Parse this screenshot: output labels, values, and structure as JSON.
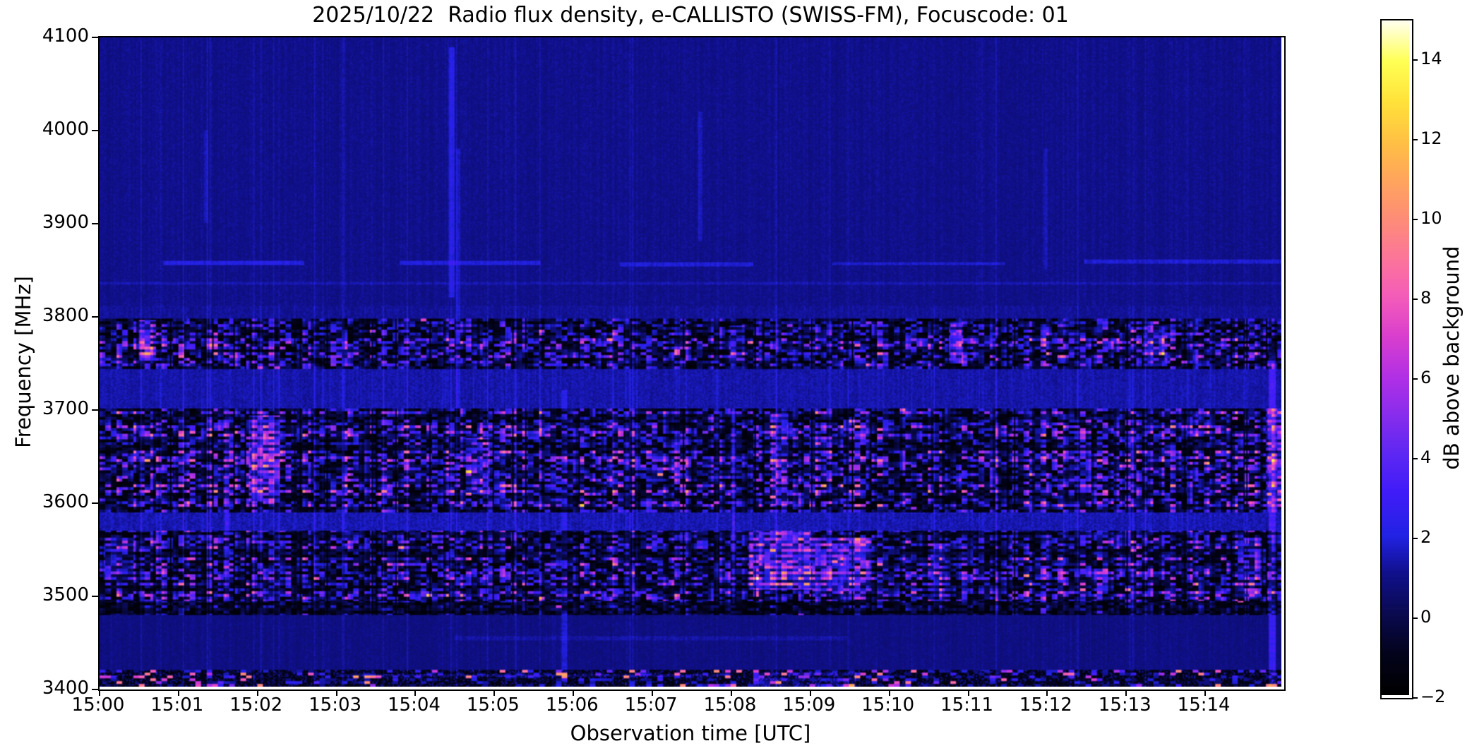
{
  "title": "2025/10/22  Radio flux density, e-CALLISTO (SWISS-FM), Focuscode: 01",
  "chart_data": {
    "type": "heatmap",
    "title": "2025/10/22  Radio flux density, e-CALLISTO (SWISS-FM), Focuscode: 01",
    "xlabel": "Observation time [UTC]",
    "ylabel": "Frequency [MHz]",
    "x_ticks": [
      "15:00",
      "15:01",
      "15:02",
      "15:03",
      "15:04",
      "15:05",
      "15:06",
      "15:07",
      "15:08",
      "15:09",
      "15:10",
      "15:11",
      "15:12",
      "15:13",
      "15:14"
    ],
    "x_range_minutes": [
      0,
      15
    ],
    "y_ticks": [
      "4100",
      "4000",
      "3900",
      "3800",
      "3700",
      "3600",
      "3500",
      "3400"
    ],
    "y_range": [
      3400,
      4100
    ],
    "grid": false,
    "colorbar": {
      "label": "dB above background",
      "ticks": [
        "14",
        "12",
        "10",
        "8",
        "6",
        "4",
        "2",
        "0",
        "−2"
      ],
      "tick_values": [
        14,
        12,
        10,
        8,
        6,
        4,
        2,
        0,
        -2
      ],
      "vmin": -2,
      "vmax": 15,
      "colormap": "gnuplot2-like",
      "colormap_stops": [
        [
          0.0,
          0,
          0,
          0
        ],
        [
          0.06,
          3,
          3,
          28
        ],
        [
          0.12,
          10,
          10,
          80
        ],
        [
          0.18,
          16,
          16,
          140
        ],
        [
          0.235,
          34,
          34,
          228
        ],
        [
          0.3,
          64,
          28,
          248
        ],
        [
          0.36,
          95,
          40,
          242
        ],
        [
          0.42,
          140,
          45,
          236
        ],
        [
          0.47,
          176,
          48,
          230
        ],
        [
          0.53,
          216,
          62,
          206
        ],
        [
          0.59,
          244,
          92,
          186
        ],
        [
          0.65,
          252,
          118,
          152
        ],
        [
          0.71,
          253,
          142,
          118
        ],
        [
          0.77,
          255,
          168,
          90
        ],
        [
          0.82,
          255,
          192,
          68
        ],
        [
          0.88,
          255,
          226,
          58
        ],
        [
          0.94,
          255,
          255,
          84
        ],
        [
          1.0,
          255,
          255,
          238
        ]
      ]
    },
    "background_color_quiet": "#14149b",
    "bands": [
      {
        "f0": 3810,
        "f1": 4100,
        "kind": "smooth",
        "base": 1.0,
        "noise": 0.45,
        "streak": 0.35,
        "seed": 3
      },
      {
        "f0": 3797,
        "f1": 3810,
        "kind": "smooth",
        "base": 1.15,
        "noise": 0.5,
        "streak": 0.55,
        "seed": 5
      },
      {
        "f0": 3743,
        "f1": 3797,
        "kind": "blocky",
        "gain": 1.0,
        "seed": 11
      },
      {
        "f0": 3700,
        "f1": 3743,
        "kind": "smooth",
        "base": 1.35,
        "noise": 0.6,
        "streak": 0.85,
        "seed": 17
      },
      {
        "f0": 3588,
        "f1": 3700,
        "kind": "blocky",
        "gain": 1.05,
        "seed": 23
      },
      {
        "f0": 3568,
        "f1": 3588,
        "kind": "smooth",
        "base": 1.45,
        "noise": 0.75,
        "streak": 1.1,
        "seed": 29
      },
      {
        "f0": 3492,
        "f1": 3568,
        "kind": "blocky",
        "gain": 1.05,
        "seed": 37
      },
      {
        "f0": 3478,
        "f1": 3492,
        "kind": "blocky",
        "gain": 0.55,
        "seed": 41
      },
      {
        "f0": 3418,
        "f1": 3478,
        "kind": "smooth",
        "base": 0.88,
        "noise": 0.45,
        "streak": 0.45,
        "seed": 47
      },
      {
        "f0": 3400,
        "f1": 3418,
        "kind": "speckle",
        "seed": 53
      }
    ],
    "hotspots": [
      {
        "m0": 0.5,
        "m1": 0.72,
        "f0": 3752,
        "f1": 3795,
        "amp": 6.5
      },
      {
        "m0": 8.0,
        "m1": 8.18,
        "f0": 3748,
        "f1": 3790,
        "amp": 3.5
      },
      {
        "m0": 10.78,
        "m1": 10.96,
        "f0": 3748,
        "f1": 3792,
        "amp": 6.0
      },
      {
        "m0": 13.25,
        "m1": 13.55,
        "f0": 3745,
        "f1": 3790,
        "amp": 4.0
      },
      {
        "m0": 1.9,
        "m1": 2.28,
        "f0": 3598,
        "f1": 3692,
        "amp": 7.0
      },
      {
        "m0": 4.65,
        "m1": 4.95,
        "f0": 3608,
        "f1": 3668,
        "amp": 4.5
      },
      {
        "m0": 8.52,
        "m1": 8.75,
        "f0": 3595,
        "f1": 3695,
        "amp": 4.0
      },
      {
        "m0": 14.8,
        "m1": 15.0,
        "f0": 3588,
        "f1": 3700,
        "amp": 5.5
      },
      {
        "m0": 8.25,
        "m1": 9.05,
        "f0": 3505,
        "f1": 3568,
        "amp": 7.5
      },
      {
        "m0": 9.05,
        "m1": 9.8,
        "f0": 3500,
        "f1": 3560,
        "amp": 6.0
      },
      {
        "m0": 10.55,
        "m1": 10.8,
        "f0": 3492,
        "f1": 3555,
        "amp": 4.0
      },
      {
        "m0": 14.45,
        "m1": 14.75,
        "f0": 3495,
        "f1": 3560,
        "amp": 4.0
      },
      {
        "m0": 0.05,
        "m1": 0.45,
        "f0": 3515,
        "f1": 3560,
        "amp": 3.0
      },
      {
        "m0": 8.3,
        "m1": 9.6,
        "f0": 3400,
        "f1": 3416,
        "amp": 2.5
      }
    ],
    "hlines": [
      {
        "f": 3857,
        "m0": 0.8,
        "m1": 2.6,
        "amp": 1.3,
        "w": 4
      },
      {
        "f": 3857,
        "m0": 3.8,
        "m1": 5.6,
        "amp": 1.1,
        "w": 4
      },
      {
        "f": 3855,
        "m0": 6.6,
        "m1": 8.3,
        "amp": 1.0,
        "w": 4
      },
      {
        "f": 3856,
        "m0": 9.3,
        "m1": 11.5,
        "amp": 0.9,
        "w": 4
      },
      {
        "f": 3858,
        "m0": 12.5,
        "m1": 15.0,
        "amp": 1.0,
        "w": 4
      },
      {
        "f": 3835,
        "m0": 0.0,
        "m1": 15.0,
        "amp": 0.5,
        "w": 3
      },
      {
        "f": 3452,
        "m0": 4.5,
        "m1": 9.5,
        "amp": 0.5,
        "w": 4
      },
      {
        "f": 3412,
        "m0": 3.0,
        "m1": 8.0,
        "amp": 1.6,
        "w": 3
      }
    ],
    "vlines": [
      {
        "m": 4.47,
        "f0": 3820,
        "f1": 4090,
        "amp": 1.3,
        "w": 0.03
      },
      {
        "m": 4.55,
        "f0": 3700,
        "f1": 3980,
        "amp": 0.8,
        "w": 0.03
      },
      {
        "m": 7.62,
        "f0": 3880,
        "f1": 4020,
        "amp": 0.7,
        "w": 0.03
      },
      {
        "m": 1.35,
        "f0": 3900,
        "f1": 4000,
        "amp": 0.6,
        "w": 0.03
      },
      {
        "m": 12.0,
        "f0": 3850,
        "f1": 3980,
        "amp": 0.5,
        "w": 0.03
      },
      {
        "m": 1.62,
        "f0": 3495,
        "f1": 3698,
        "amp": 1.8,
        "w": 0.025
      },
      {
        "m": 8.05,
        "f0": 3490,
        "f1": 3700,
        "amp": 2.0,
        "w": 0.02
      },
      {
        "m": 5.9,
        "f0": 3400,
        "f1": 3720,
        "amp": 1.1,
        "w": 0.03
      },
      {
        "m": 14.88,
        "f0": 3400,
        "f1": 3760,
        "amp": 2.2,
        "w": 0.04
      }
    ],
    "seed": 42
  }
}
